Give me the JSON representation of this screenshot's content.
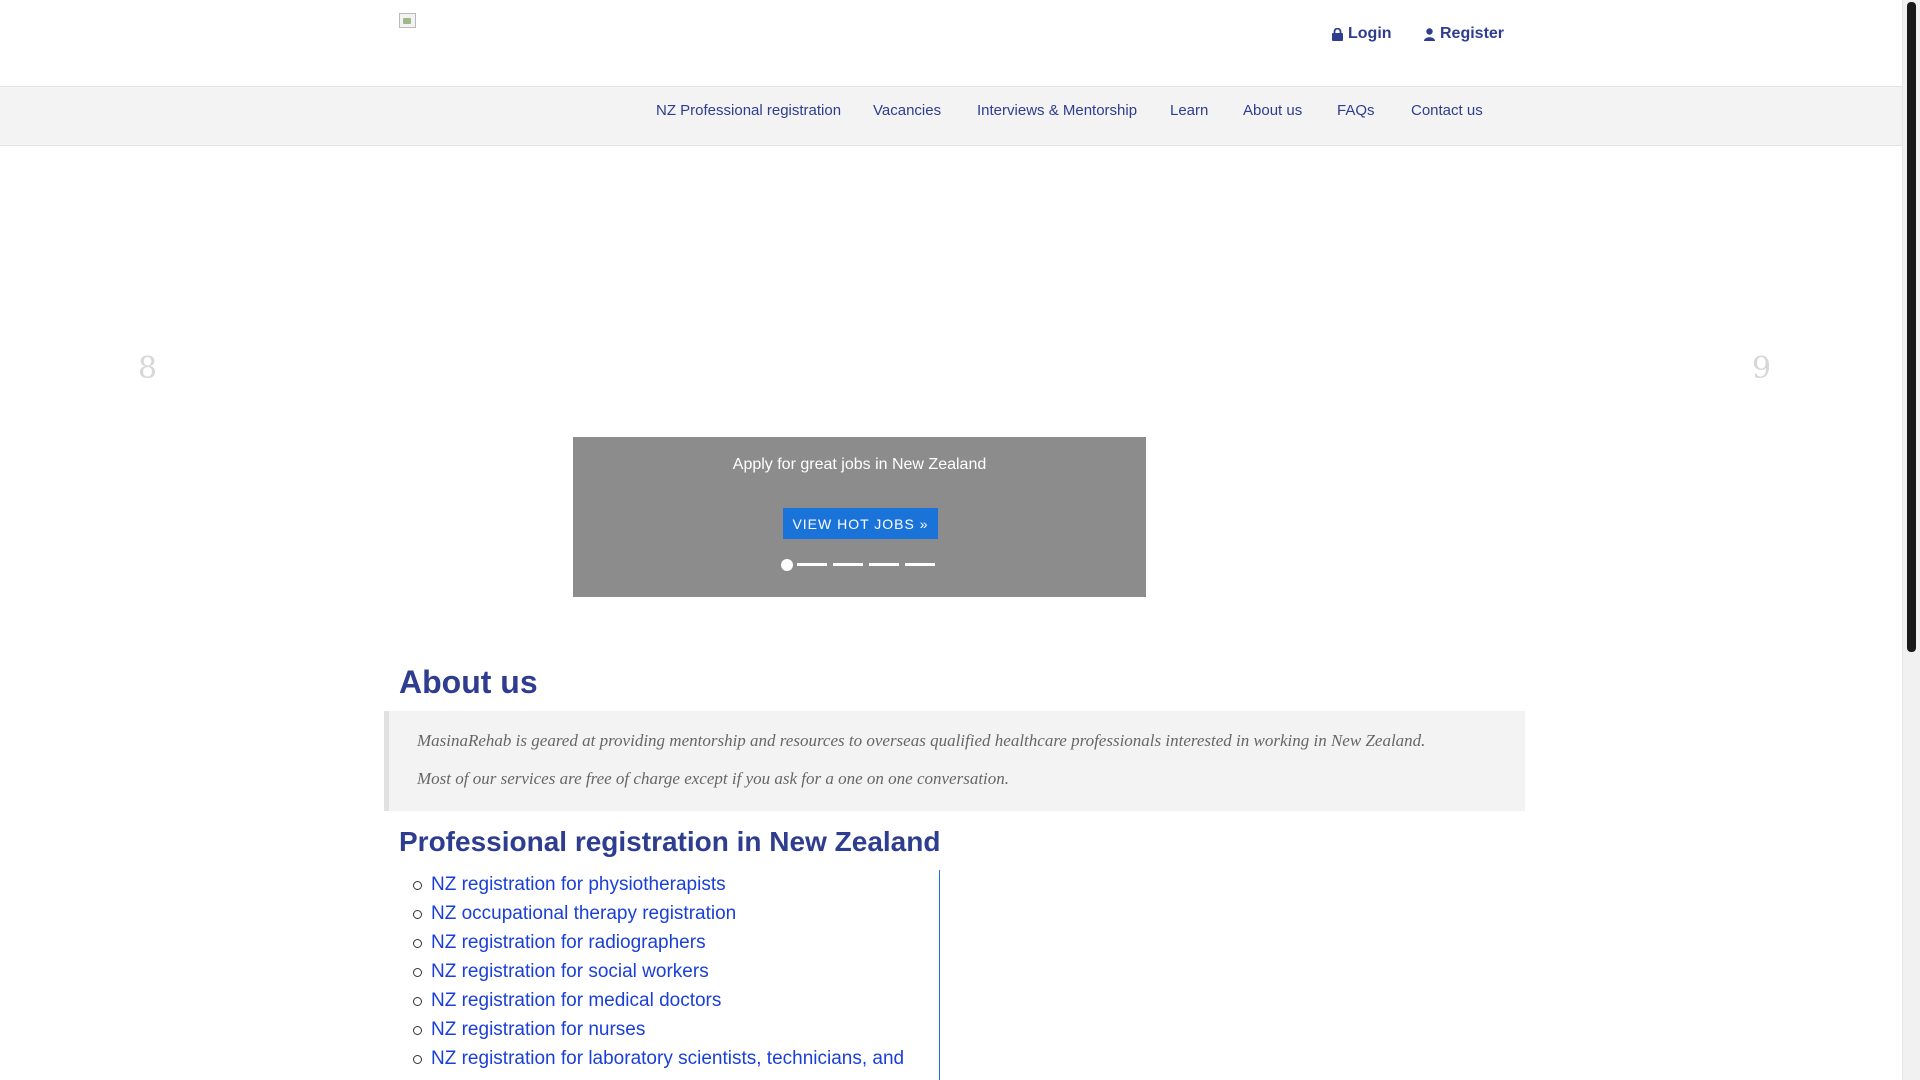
{
  "header": {
    "login_label": "Login",
    "register_label": "Register"
  },
  "nav": {
    "items": [
      "NZ Professional registration",
      "Vacancies",
      "Interviews & Mentorship",
      "Learn",
      "About us",
      "FAQs",
      "Contact us"
    ]
  },
  "carousel": {
    "prev_glyph": "8",
    "next_glyph": "9",
    "caption": "Apply for great jobs in New Zealand",
    "cta_label": "VIEW HOT JOBS »",
    "slides_total": 5,
    "active_slide": 1
  },
  "about": {
    "title": "About us",
    "paragraphs": [
      "MasinaRehab is geared at providing mentorship and resources to overseas qualified healthcare professionals interested in working in New Zealand.",
      "Most of our services are free of charge except if you ask for a one on one conversation."
    ]
  },
  "registration": {
    "title": "Professional registration in New Zealand",
    "links": [
      "NZ registration for physiotherapists",
      "NZ occupational therapy registration",
      "NZ registration for radiographers",
      "NZ registration for social workers",
      "NZ registration for medical doctors",
      "NZ registration for nurses",
      "NZ registration for laboratory scientists, technicians, and"
    ]
  },
  "colors": {
    "brand_blue": "#2e3d8f",
    "link_blue": "#1a3fd9",
    "cta_blue": "#1a73d9",
    "nav_bg": "#f3f3f3"
  }
}
